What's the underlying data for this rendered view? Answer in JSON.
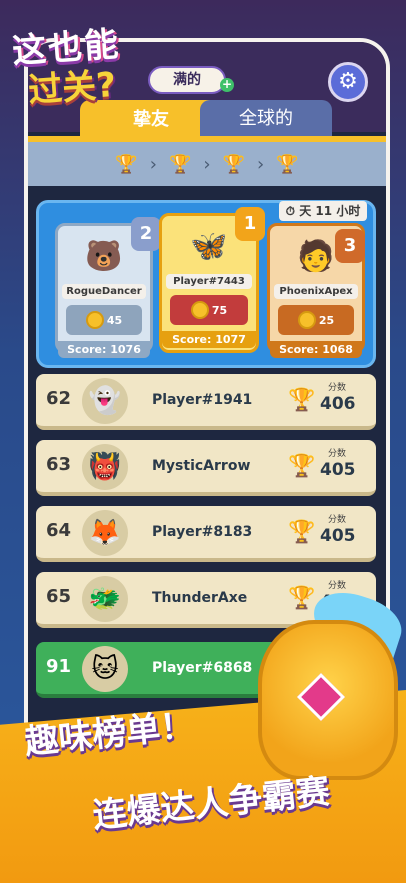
{
  "app": {
    "logo_line1": "这也能",
    "logo_line2": "过关?"
  },
  "tabs": [
    {
      "label": "挚友"
    },
    {
      "label": "全球的"
    }
  ],
  "tab_pill": {
    "label": "满的"
  },
  "settings": {
    "icon": "gear-icon"
  },
  "trophy_row": {
    "icon": "trophy-icon"
  },
  "timer": {
    "prefix": "天",
    "value": "11",
    "unit": "小时"
  },
  "podium": [
    {
      "rank": "2",
      "name": "RogueDancer",
      "coins": "45",
      "score": "Score: 1076",
      "avatar": "🐻"
    },
    {
      "rank": "1",
      "name": "Player#7443",
      "coins": "75",
      "score": "Score: 1077",
      "avatar": "🦋"
    },
    {
      "rank": "3",
      "name": "PhoenixApex",
      "coins": "25",
      "score": "Score: 1068",
      "avatar": "🧑"
    }
  ],
  "list": [
    {
      "rank": "62",
      "name": "Player#1941",
      "label": "分数",
      "score": "406",
      "avatar": "👻"
    },
    {
      "rank": "63",
      "name": "MysticArrow",
      "label": "分数",
      "score": "405",
      "avatar": "👹"
    },
    {
      "rank": "64",
      "name": "Player#8183",
      "label": "分数",
      "score": "405",
      "avatar": "🦊"
    },
    {
      "rank": "65",
      "name": "ThunderAxe",
      "label": "分数",
      "score": "405",
      "avatar": "🐲"
    },
    {
      "rank": "91",
      "name": "Player#6868",
      "label": "",
      "score": "",
      "avatar": "🐱"
    }
  ],
  "banner": {
    "line1": "趣味榜单！",
    "line2": "连爆达人争霸赛"
  }
}
